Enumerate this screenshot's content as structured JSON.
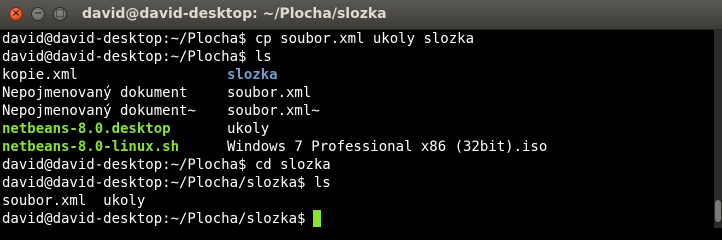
{
  "window": {
    "title": "david@david-desktop: ~/Plocha/slozka",
    "close_glyph": "×",
    "minimize_glyph": "−",
    "maximize_glyph": "□"
  },
  "colors": {
    "background": "#000000",
    "text": "#ffffff",
    "directory": "#729fcf",
    "executable": "#8ae234",
    "cursor": "#8ae234",
    "close_button": "#e0501c"
  },
  "terminal": {
    "lines": {
      "l1": {
        "prompt": "david@david-desktop:~/Plocha$",
        "command": " cp soubor.xml ukoly slozka"
      },
      "l2": {
        "prompt": "david@david-desktop:~/Plocha$",
        "command": " ls"
      },
      "l3": {
        "a": "kopie.xml",
        "b": "slozka"
      },
      "l4": {
        "a": "Nepojmenovaný dokument",
        "b": "soubor.xml"
      },
      "l5": {
        "a": "Nepojmenovaný dokument~",
        "b": "soubor.xml~"
      },
      "l6": {
        "a": "netbeans-8.0.desktop",
        "b": "ukoly"
      },
      "l7": {
        "a": "netbeans-8.0-linux.sh",
        "b": "Windows 7 Professional x86 (32bit).iso"
      },
      "l8": {
        "prompt": "david@david-desktop:~/Plocha$",
        "command": " cd slozka"
      },
      "l9": {
        "prompt": "david@david-desktop:~/Plocha/slozka$",
        "command": " ls"
      },
      "l10": {
        "output": "soubor.xml  ukoly"
      },
      "l11": {
        "prompt": "david@david-desktop:~/Plocha/slozka$"
      }
    }
  }
}
